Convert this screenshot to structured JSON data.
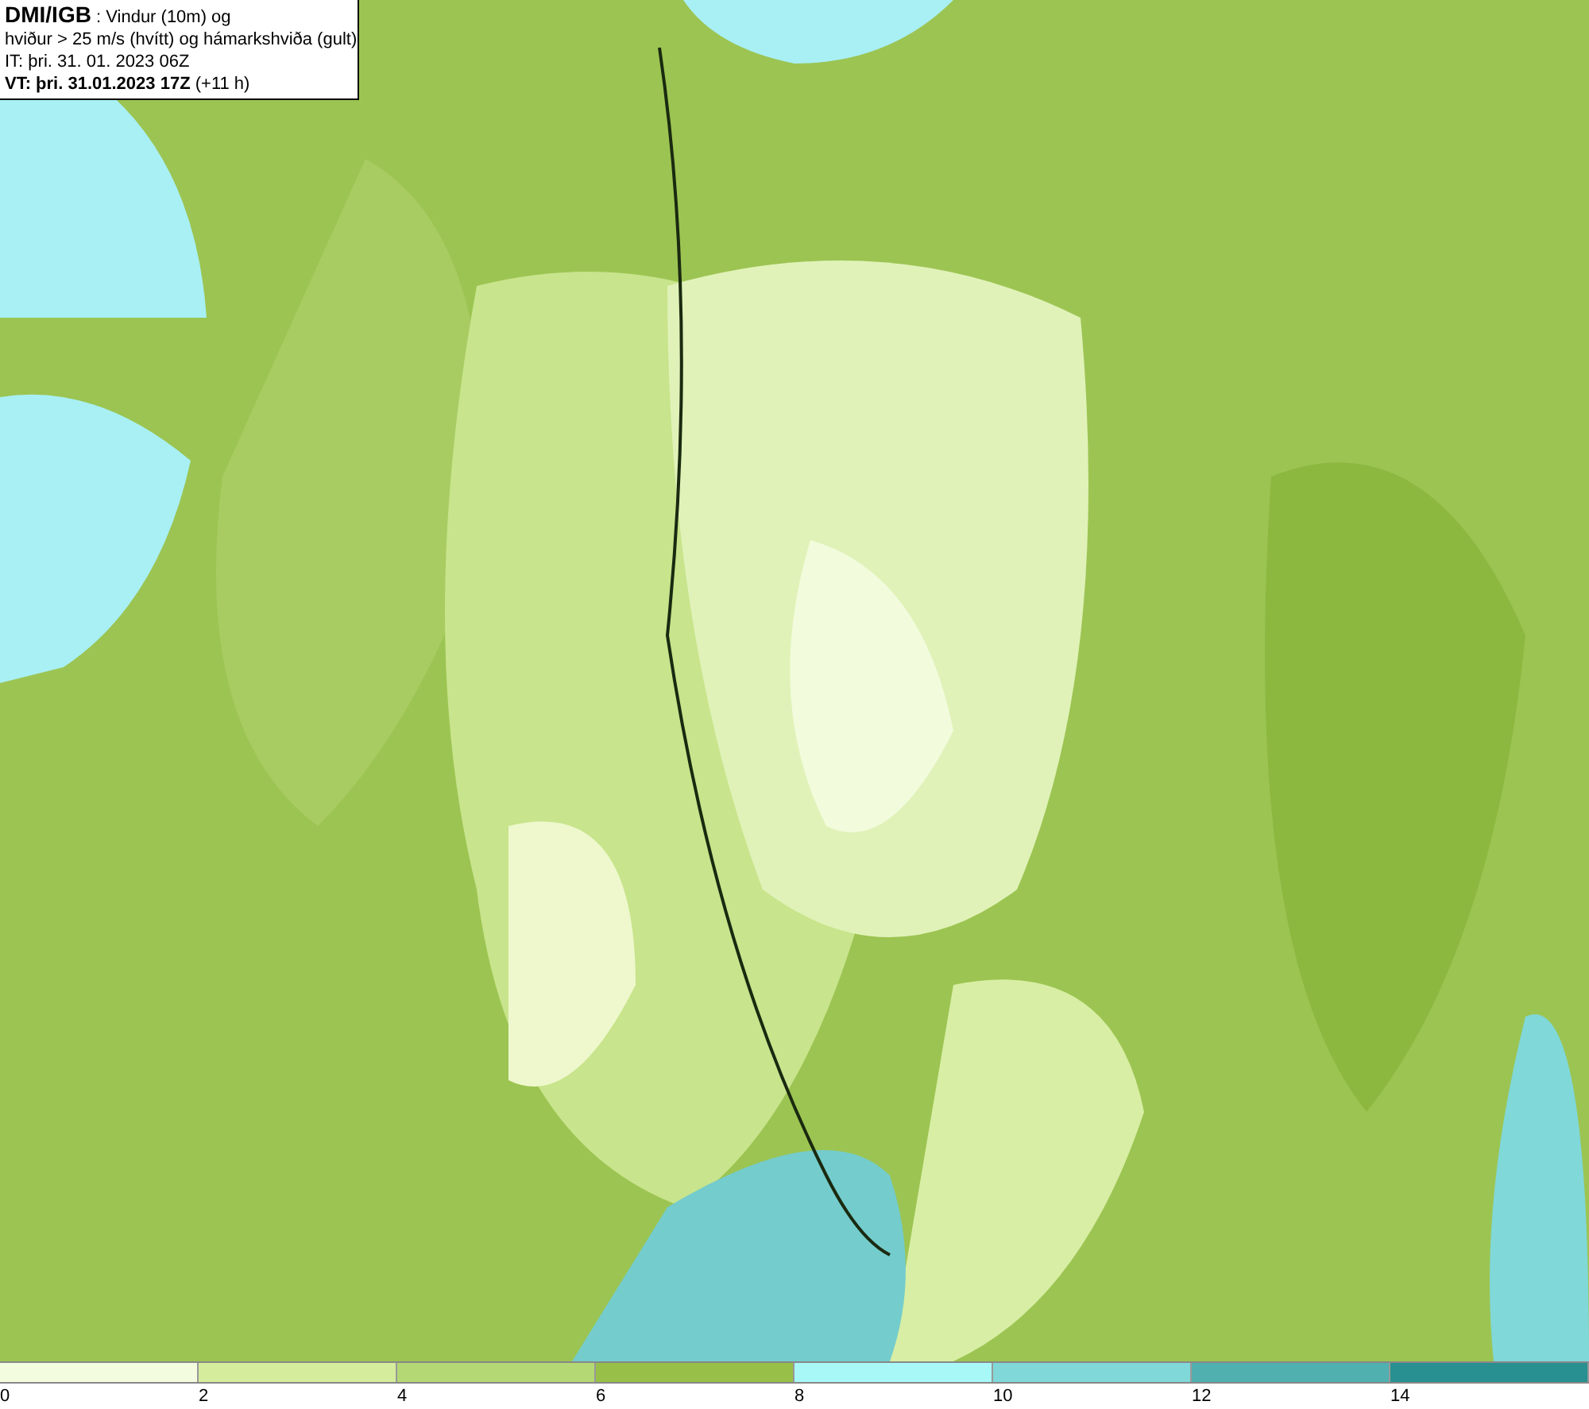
{
  "title_box": {
    "lines": [
      "**DMI/IGB** : Vindur (10m) og",
      "hviður > 25 m/s (hvítt) og hámarkshviða (gult)",
      "IT: þri. 31. 01. 2023 06Z",
      "**VT: þri. 31.01.2023 17Z** (+11 h)"
    ]
  },
  "legend": {
    "bins": [
      {
        "color": "#f4fce0"
      },
      {
        "color": "#d4ec9c"
      },
      {
        "color": "#b4d874"
      },
      {
        "color": "#98c048"
      },
      {
        "color": "#a8f8f8"
      },
      {
        "color": "#80d8d8"
      },
      {
        "color": "#50b0b0"
      },
      {
        "color": "#289090"
      }
    ],
    "labels": [
      "0",
      "2",
      "4",
      "6",
      "8",
      "10",
      "12",
      "14"
    ]
  }
}
